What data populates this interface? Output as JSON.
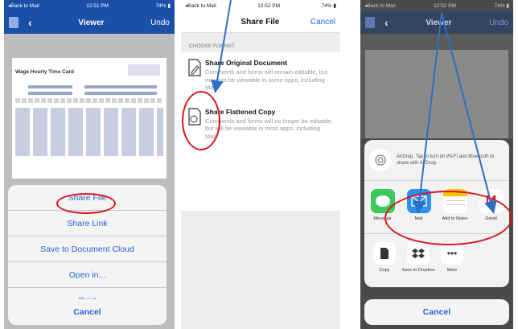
{
  "phone1": {
    "status": {
      "back": "◂Back to Mail",
      "time": "12:51 PM",
      "battery": "74%"
    },
    "nav": {
      "title": "Viewer",
      "right": "Undo"
    },
    "doc_title": "Wage Hourly Time Card",
    "actions": [
      "Share File",
      "Share Link",
      "Save to Document Cloud",
      "Open in...",
      "Print"
    ],
    "cancel": "Cancel"
  },
  "phone2": {
    "status": {
      "back": "◂Back to Mail",
      "time": "12:52 PM",
      "battery": "74%"
    },
    "nav": {
      "title": "Share File",
      "right": "Cancel"
    },
    "section": "CHOOSE FORMAT",
    "options": [
      {
        "title": "Share Original Document",
        "desc": "Comments and forms will remain editable, but may not be viewable in some apps, including Mail."
      },
      {
        "title": "Share Flattened Copy",
        "desc": "Comments and forms will no longer be editable, but will be viewable in most apps, including Mail."
      }
    ]
  },
  "phone3": {
    "status": {
      "back": "◂Back to Mail",
      "time": "12:52 PM",
      "battery": "74%"
    },
    "nav": {
      "title": "Viewer",
      "right": "Undo"
    },
    "airdrop": "AirDrop. Tap to turn on Wi-Fi and Bluetooth to share with AirDrop.",
    "apps": [
      "Message",
      "Mail",
      "Add to Notes",
      "Gmail"
    ],
    "actions": [
      "Copy",
      "Save to Dropbox",
      "More"
    ],
    "cancel": "Cancel"
  },
  "colors": {
    "accent": "#2763d8",
    "highlight": "#d6181b",
    "arrow": "#2e6fc4"
  }
}
